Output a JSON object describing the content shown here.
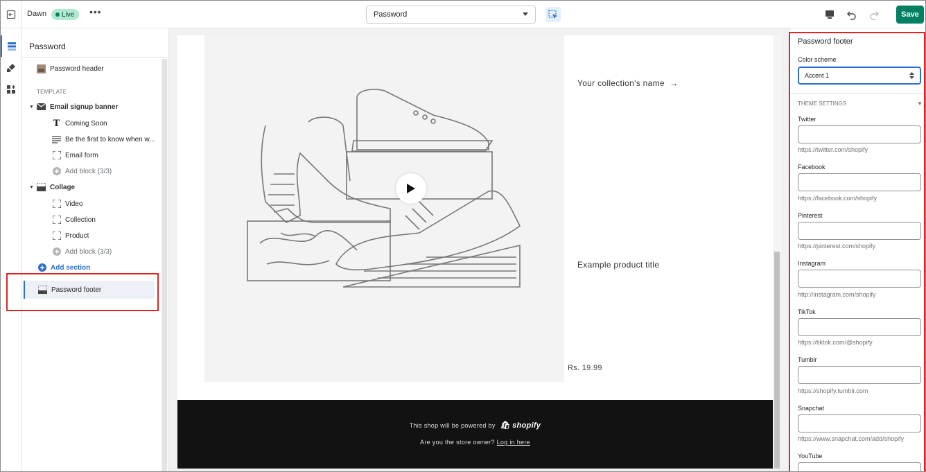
{
  "topbar": {
    "theme_name": "Dawn",
    "status_badge": "Live",
    "more_label": "•••",
    "page_select_value": "Password",
    "save_label": "Save"
  },
  "sidebar": {
    "title": "Password",
    "header_section": "Password header",
    "template_label": "TEMPLATE",
    "email_banner": {
      "label": "Email signup banner",
      "blocks": [
        "Coming Soon",
        "Be the first to know when w...",
        "Email form"
      ],
      "add_block": "Add block (3/3)"
    },
    "collage": {
      "label": "Collage",
      "blocks": [
        "Video",
        "Collection",
        "Product"
      ],
      "add_block": "Add block (3/3)"
    },
    "add_section": "Add section",
    "footer_section": "Password footer"
  },
  "preview": {
    "collection_name": "Your collection's name",
    "arrow": "→",
    "product_title": "Example product title",
    "price": "Rs. 19.99",
    "powered_text": "This shop will be powered by",
    "shopify_logo_text": "shopify",
    "owner_text": "Are you the store owner?",
    "login_link": "Log in here"
  },
  "settings": {
    "title": "Password footer",
    "color_scheme_label": "Color scheme",
    "color_scheme_value": "Accent 1",
    "theme_settings_label": "THEME SETTINGS",
    "fields": [
      {
        "label": "Twitter",
        "value": "",
        "hint": "https://twitter.com/shopify"
      },
      {
        "label": "Facebook",
        "value": "",
        "hint": "https://facebook.com/shopify"
      },
      {
        "label": "Pinterest",
        "value": "",
        "hint": "https://pinterest.com/shopify"
      },
      {
        "label": "Instagram",
        "value": "",
        "hint": "http://instagram.com/shopify"
      },
      {
        "label": "TikTok",
        "value": "",
        "hint": "https://tiktok.com/@shopify"
      },
      {
        "label": "Tumblr",
        "value": "",
        "hint": "https://shopify.tumblr.com"
      },
      {
        "label": "Snapchat",
        "value": "",
        "hint": "https://www.snapchat.com/add/shopify"
      },
      {
        "label": "YouTube",
        "value": "",
        "hint": ""
      }
    ]
  },
  "colors": {
    "accent": "#2c6ecb",
    "save": "#008060",
    "highlight": "#e02424",
    "live_badge": "#aee9d1"
  }
}
